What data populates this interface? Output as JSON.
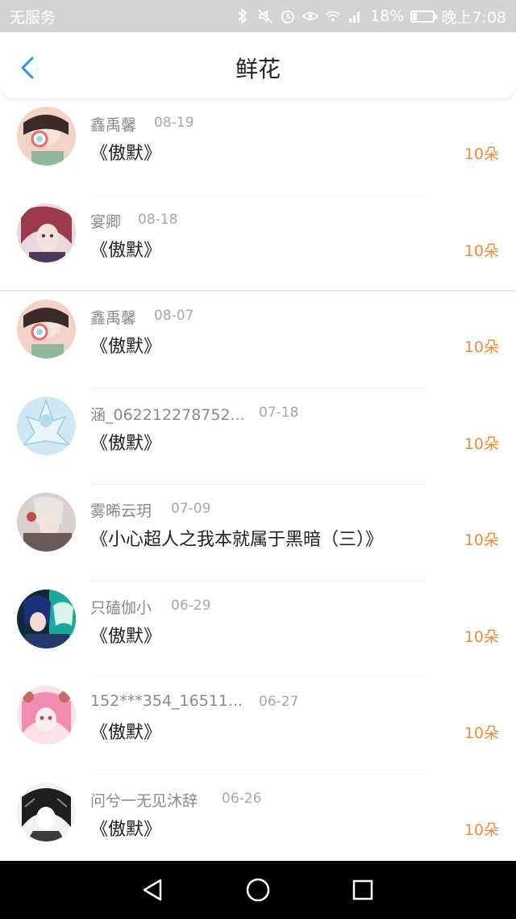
{
  "status_bar": {
    "carrier": "无服务",
    "battery": "18%",
    "time": "晚上7:08",
    "icons": [
      "bluetooth-icon",
      "mute-icon",
      "alarm-icon",
      "eye-icon",
      "wifi-icon",
      "signal-icon",
      "battery-icon"
    ]
  },
  "header": {
    "title": "鲜花",
    "back_icon": "chevron-left-icon"
  },
  "colors": {
    "accent": "#2196f3",
    "count": "#f08a3a",
    "name": "#8a8a8a",
    "date": "#a8a8a8",
    "status_bar": "#d3d3d3"
  },
  "items": [
    {
      "name": "鑫禹馨",
      "date": "08-19",
      "book": "《傲默》",
      "count": "10朵"
    },
    {
      "name": "宴卿",
      "date": "08-18",
      "book": "《傲默》",
      "count": "10朵"
    },
    {
      "name": "鑫禹馨",
      "date": "08-07",
      "book": "《傲默》",
      "count": "10朵"
    },
    {
      "name": "涵_062212278752...",
      "date": "07-18",
      "book": "《傲默》",
      "count": "10朵"
    },
    {
      "name": "雾晞云玥",
      "date": "07-09",
      "book": "《小心超人之我本就属于黑暗（三）》",
      "count": "10朵"
    },
    {
      "name": "只磕伽小",
      "date": "06-29",
      "book": "《傲默》",
      "count": "10朵"
    },
    {
      "name": "152***354_16511...",
      "date": "06-27",
      "book": "《傲默》",
      "count": "10朵"
    },
    {
      "name": "问兮一无见沐辞",
      "date": "06-26",
      "book": "《傲默》",
      "count": "10朵"
    }
  ],
  "nav": {
    "back_icon": "nav-back-icon",
    "home_icon": "nav-home-icon",
    "recents_icon": "nav-recents-icon"
  }
}
